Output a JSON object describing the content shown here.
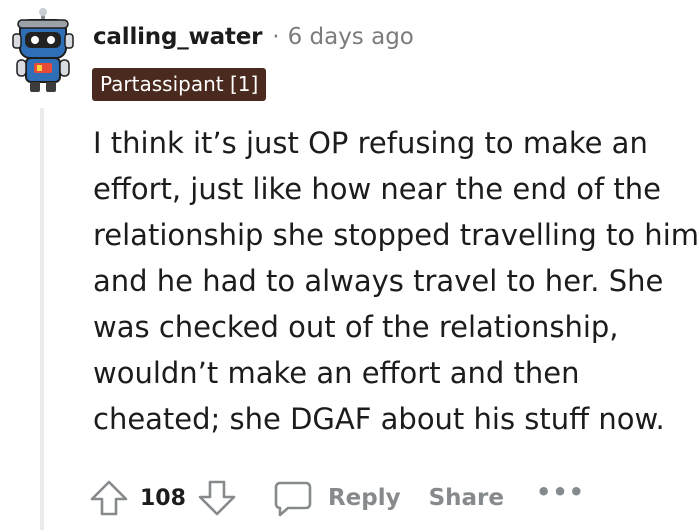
{
  "comment": {
    "author": "calling_water",
    "separator": "·",
    "time_ago": "6 days ago",
    "flair": "Partassipant [1]",
    "body_lines": [
      "I think it’s just OP refusing to make an",
      "effort, just like how near the end of the",
      "relationship she stopped travelling to him",
      "and he had to always travel to her. She",
      "was checked out of the relationship,",
      "wouldn’t make an effort and then",
      "cheated; she DGAF about his stuff now."
    ]
  },
  "actions": {
    "upvote_icon": "upvote-arrow-icon",
    "score": "108",
    "downvote_icon": "downvote-arrow-icon",
    "reply_icon": "speech-bubble-icon",
    "reply_label": "Reply",
    "share_label": "Share",
    "more_label": "•••"
  },
  "colors": {
    "flair_bg": "#4a2a1e",
    "muted_text": "#878a8c",
    "thread_line": "#e9ebed"
  }
}
